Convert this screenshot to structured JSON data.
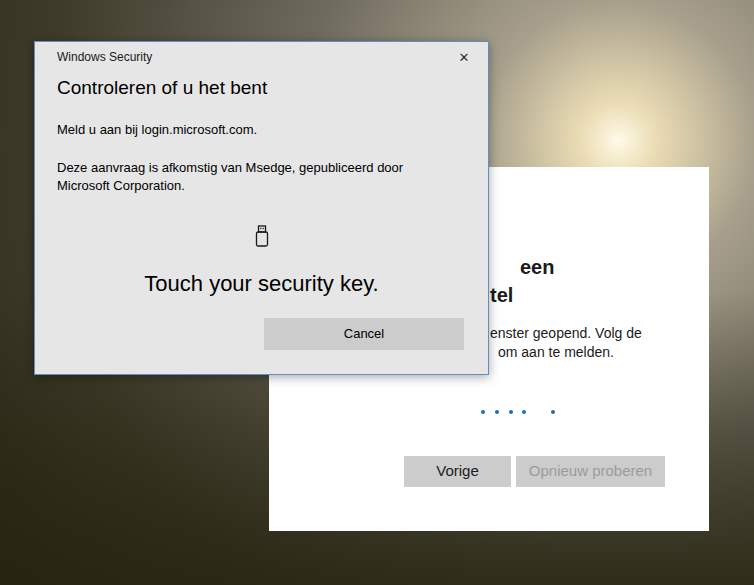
{
  "dialog": {
    "app": "Windows Security",
    "close": "✕",
    "title": "Controleren of u het bent",
    "site_line": "Meld u aan bij login.microsoft.com.",
    "source_lines": [
      "Deze aanvraag is afkomstig van Msedge, gepubliceerd door",
      "Microsoft Corporation."
    ],
    "prompt": "Touch your security key.",
    "cancel": "Cancel"
  },
  "panel": {
    "heading_lines": [
      "een",
      "tel"
    ],
    "body_lines": [
      "enster geopend. Volg de",
      "om aan te melden."
    ],
    "loading": true,
    "buttons": [
      {
        "label": "Vorige",
        "disabled": false
      },
      {
        "label": "Opnieuw proberen",
        "disabled": true
      }
    ]
  }
}
